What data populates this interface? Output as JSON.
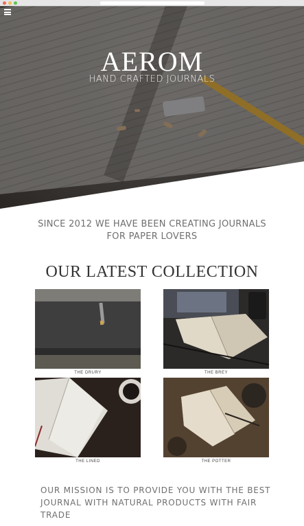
{
  "hero": {
    "brand": "AEROM",
    "tagline": "HAND CRAFTED JOURNALS",
    "menu_icon": "hamburger-menu-icon"
  },
  "intro": {
    "line1": "SINCE 2012 WE HAVE BEEN CREATING JOURNALS",
    "line2": "FOR PAPER LOVERS"
  },
  "collection": {
    "title": "OUR LATEST COLLECTION",
    "items": [
      {
        "name": "THE DRURY"
      },
      {
        "name": "THE BREY"
      },
      {
        "name": "THE LINED"
      },
      {
        "name": "THE POTTER"
      }
    ]
  },
  "mission": {
    "line1": "OUR MISSION IS TO PROVIDE YOU WITH THE BEST",
    "line2": "JOURNAL WITH NATURAL PRODUCTS WITH FAIR TRADE"
  }
}
